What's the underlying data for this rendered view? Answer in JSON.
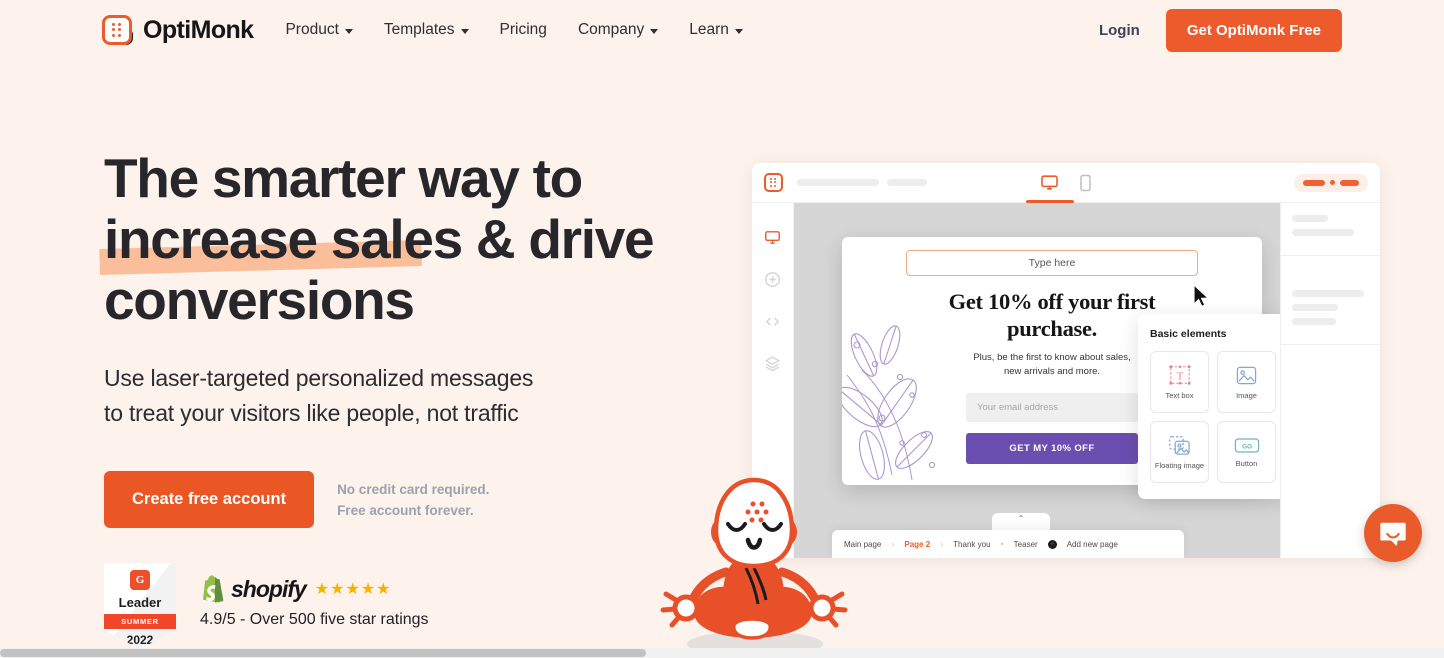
{
  "nav": {
    "brand": "OptiMonk",
    "brand_icon": "optimonk-grid-logo-icon",
    "links": [
      {
        "label": "Product",
        "caret": true
      },
      {
        "label": "Templates",
        "caret": true
      },
      {
        "label": "Pricing",
        "caret": false
      },
      {
        "label": "Company",
        "caret": true
      },
      {
        "label": "Learn",
        "caret": true
      }
    ],
    "login": "Login",
    "cta": "Get OptiMonk Free"
  },
  "hero": {
    "headline_part1": "The smarter way to ",
    "headline_highlight": "increase sales",
    "headline_part2": " & drive conversions",
    "subhead_line1": "Use laser-targeted personalized messages",
    "subhead_line2": "to treat your visitors like people, not traffic",
    "cta_label": "Create free account",
    "note_line1": "No credit card required.",
    "note_line2": "Free account forever."
  },
  "badges": {
    "g2": {
      "mark": "G",
      "title": "Leader",
      "season": "SUMMER",
      "year": "2022"
    },
    "shopify": {
      "word": "shopify",
      "stars": "★★★★★",
      "rating_text": "4.9/5 - Over 500 five star ratings"
    }
  },
  "mockup": {
    "devices": [
      {
        "name": "desktop-view-icon",
        "active": true
      },
      {
        "name": "mobile-view-icon",
        "active": false
      }
    ],
    "sidebar_icons": [
      "display-icon",
      "add-circle-icon",
      "code-brackets-icon",
      "layers-icon"
    ],
    "popup": {
      "type_here": "Type here",
      "heading": "Get 10% off your first purchase.",
      "sub_line1": "Plus, be the first to know about sales,",
      "sub_line2": "new arrivals and more.",
      "email_placeholder": "Your email address",
      "button": "GET MY 10% OFF"
    },
    "elements_panel": {
      "title": "Basic elements",
      "items": [
        {
          "label": "Text box",
          "icon": "text-box-icon"
        },
        {
          "label": "Image",
          "icon": "image-icon"
        },
        {
          "label": "Floating image",
          "icon": "floating-image-icon"
        },
        {
          "label": "Button",
          "icon": "button-go-icon"
        }
      ]
    },
    "pagebar": {
      "collapse": "⌃",
      "items": [
        {
          "label": "Main page",
          "active": false,
          "sep": "›"
        },
        {
          "label": "Page 2",
          "active": true,
          "sep": "›"
        },
        {
          "label": "Thank you",
          "active": false,
          "sep": "•"
        },
        {
          "label": "Teaser",
          "active": false,
          "sep": ""
        }
      ],
      "add_label": "Add new page"
    }
  },
  "widgets": {
    "chat_icon": "intercom-chat-icon",
    "mascot": "meditating-monk-mascot"
  },
  "colors": {
    "background": "#FDF2EC",
    "brand_orange": "#EA5724",
    "highlight_peach": "#FBBE9A",
    "popup_purple": "#6B4FB0",
    "star_gold": "#F5B301"
  }
}
